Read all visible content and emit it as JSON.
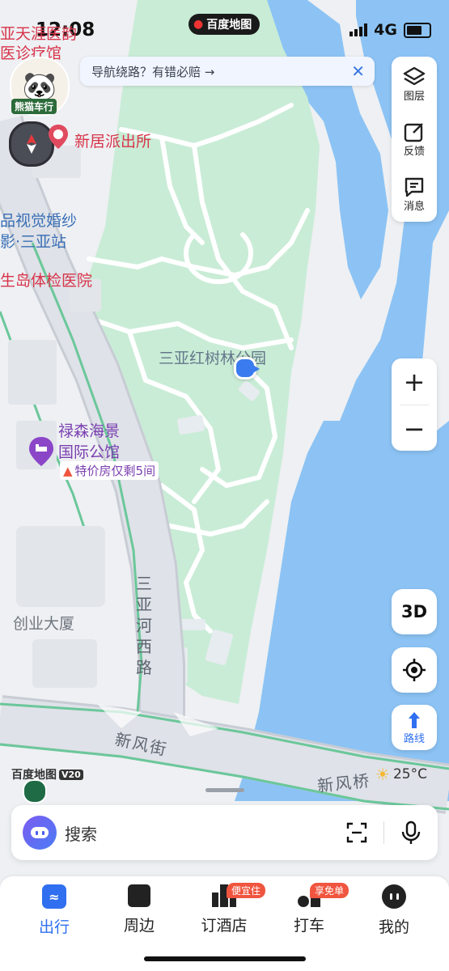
{
  "status_bar": {
    "time": "12:08",
    "network": "4G",
    "app_label": "百度地图"
  },
  "map": {
    "labels": {
      "clinic": "亚天涯医韵\n医诊疗馆",
      "police": "新居派出所",
      "wedding": "品视觉婚纱\n影·三亚站",
      "hospital": "生岛体检医院",
      "park": "三亚红树林公园",
      "hotel_name": "禄森海景\n国际公馆",
      "hotel_deal": "特价房仅剩5间",
      "building": "创业大厦",
      "road_sanya": "三\n亚\n河\n西\n路",
      "road_xinfeng": "新风街",
      "road_bridge": "新风桥"
    },
    "avatar_label": "熊猫车行",
    "brand_version": "百度地图",
    "brand_version_tag": "V20",
    "weather": "25°C"
  },
  "banner": {
    "text": "导航绕路？有错必赔 →"
  },
  "toolbar": {
    "layers": "图层",
    "feedback": "反馈",
    "messages": "消息"
  },
  "zoom": {
    "in": "+",
    "out": "−"
  },
  "buttons": {
    "three_d": "3D",
    "route": "路线"
  },
  "search": {
    "placeholder": "搜索"
  },
  "bottom_nav": [
    {
      "label": "出行",
      "active": true,
      "badge": ""
    },
    {
      "label": "周边",
      "active": false,
      "badge": ""
    },
    {
      "label": "订酒店",
      "active": false,
      "badge": "便宜住"
    },
    {
      "label": "打车",
      "active": false,
      "badge": "享免单"
    },
    {
      "label": "我的",
      "active": false,
      "badge": ""
    }
  ],
  "colors": {
    "water": "#8cc3f4",
    "park": "#c9ecd6",
    "road": "#dfe2e8",
    "accent": "#2f6ff0",
    "badge": "#f0553f"
  }
}
